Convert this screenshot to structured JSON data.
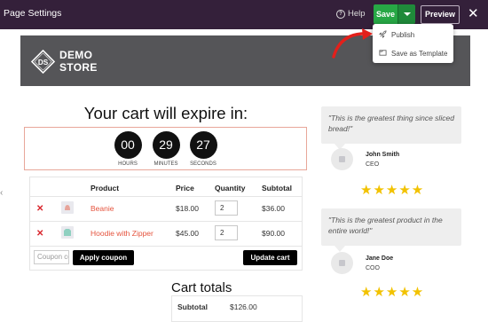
{
  "topbar": {
    "title": "Page Settings",
    "help_label": "Help",
    "save_label": "Save",
    "preview_label": "Preview",
    "close_icon": "close-icon"
  },
  "dropdown": {
    "items": [
      {
        "label": "Publish",
        "icon": "rocket-icon"
      },
      {
        "label": "Save as Template",
        "icon": "template-icon"
      }
    ]
  },
  "banner": {
    "logo_letters": "DS",
    "brand_line1": "DEMO",
    "brand_line2": "STORE"
  },
  "countdown": {
    "title": "Your cart will expire in:",
    "units": [
      {
        "value": "00",
        "label": "HOURS"
      },
      {
        "value": "29",
        "label": "MINUTES"
      },
      {
        "value": "27",
        "label": "SECONDS"
      }
    ]
  },
  "cart": {
    "headers": {
      "product": "Product",
      "price": "Price",
      "quantity": "Quantity",
      "subtotal": "Subtotal"
    },
    "rows": [
      {
        "name": "Beanie",
        "price": "$18.00",
        "qty": "2",
        "subtotal": "$36.00"
      },
      {
        "name": "Hoodie with Zipper",
        "price": "$45.00",
        "qty": "2",
        "subtotal": "$90.00"
      }
    ],
    "coupon_placeholder": "Coupon code",
    "apply_label": "Apply coupon",
    "update_label": "Update cart"
  },
  "totals": {
    "title": "Cart totals",
    "subtotal_label": "Subtotal",
    "subtotal_value": "$126.00"
  },
  "testimonials": [
    {
      "quote": "\"This is the greatest thing since sliced bread!\"",
      "name": "John Smith",
      "role": "CEO",
      "stars": "★★★★★"
    },
    {
      "quote": "\"This is the greatest product in the entire world!\"",
      "name": "Jane Doe",
      "role": "COO",
      "stars": "★★★★★"
    }
  ],
  "colors": {
    "topbar": "#34203a",
    "save_green": "#27a745",
    "link_orange": "#e5533d",
    "remove_red": "#d9272e",
    "star_gold": "#f2c200"
  }
}
